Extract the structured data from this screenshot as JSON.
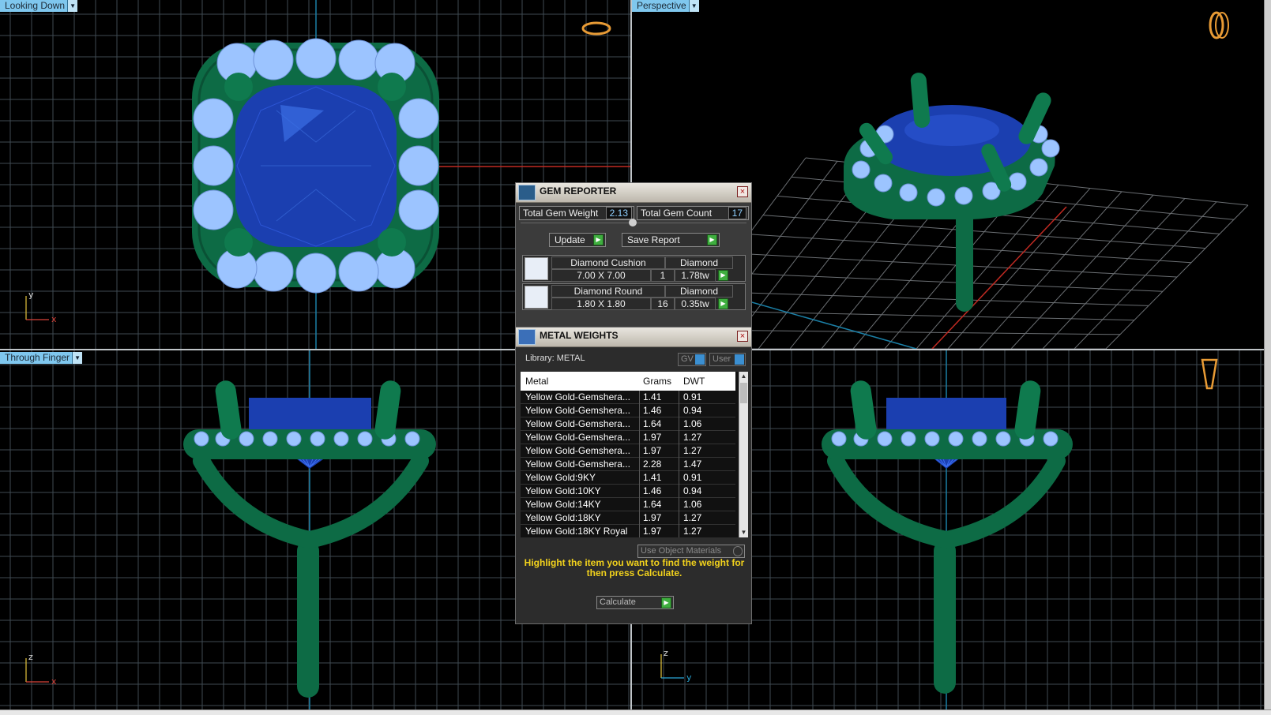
{
  "viewports": {
    "top_left": {
      "label": "Looking Down",
      "axis_h": "x",
      "axis_v": "y"
    },
    "top_right": {
      "label": "Perspective"
    },
    "bottom_left": {
      "label": "Through Finger",
      "axis_h": "x",
      "axis_v": "z"
    },
    "bottom_right": {
      "axis_h": "y",
      "axis_v": "z"
    }
  },
  "gem_reporter": {
    "title": "GEM REPORTER",
    "close": "×",
    "total_weight_label": "Total Gem Weight",
    "total_weight": "2.13",
    "total_count_label": "Total Gem Count",
    "total_count": "17",
    "update_label": "Update",
    "save_label": "Save Report",
    "gems": [
      {
        "shape": "Diamond Cushion",
        "material": "Diamond",
        "size": "7.00 X 7.00",
        "count": "1",
        "weight": "1.78tw"
      },
      {
        "shape": "Diamond Round",
        "material": "Diamond",
        "size": "1.80 X 1.80",
        "count": "16",
        "weight": "0.35tw"
      }
    ]
  },
  "metal_weights": {
    "title": "METAL WEIGHTS",
    "close": "×",
    "library": "Library: METAL",
    "gv_label": "GV",
    "user_label": "User",
    "columns": [
      "Metal",
      "Grams",
      "DWT"
    ],
    "rows": [
      {
        "metal": "Yellow Gold-Gemshera...",
        "grams": "1.41",
        "dwt": "0.91"
      },
      {
        "metal": "Yellow Gold-Gemshera...",
        "grams": "1.46",
        "dwt": "0.94"
      },
      {
        "metal": "Yellow Gold-Gemshera...",
        "grams": "1.64",
        "dwt": "1.06"
      },
      {
        "metal": "Yellow Gold-Gemshera...",
        "grams": "1.97",
        "dwt": "1.27"
      },
      {
        "metal": "Yellow Gold-Gemshera...",
        "grams": "1.97",
        "dwt": "1.27"
      },
      {
        "metal": "Yellow Gold-Gemshera...",
        "grams": "2.28",
        "dwt": "1.47"
      },
      {
        "metal": "Yellow Gold:9KY",
        "grams": "1.41",
        "dwt": "0.91"
      },
      {
        "metal": "Yellow Gold:10KY",
        "grams": "1.46",
        "dwt": "0.94"
      },
      {
        "metal": "Yellow Gold:14KY",
        "grams": "1.64",
        "dwt": "1.06"
      },
      {
        "metal": "Yellow Gold:18KY",
        "grams": "1.97",
        "dwt": "1.27"
      },
      {
        "metal": "Yellow Gold:18KY Royal",
        "grams": "1.97",
        "dwt": "1.27"
      }
    ],
    "use_object_materials": "Use Object Materials",
    "hint": "Highlight the item you want to find the weight for then press Calculate.",
    "calculate_label": "Calculate"
  },
  "colors": {
    "metal": "#0d6b45",
    "gem": "#1b3fb0",
    "accent_gem": "#9cc4ff",
    "grid": "#3f4a52",
    "label_bg": "#7fc7ee",
    "highlight": "#f2d21c"
  }
}
